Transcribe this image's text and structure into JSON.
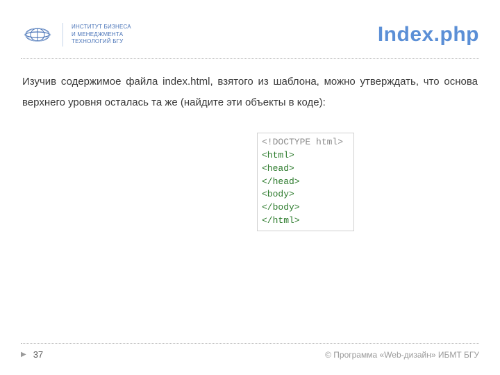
{
  "org": {
    "line1": "ИНСТИТУТ БИЗНЕСА",
    "line2": "И МЕНЕДЖМЕНТА",
    "line3": "ТЕХНОЛОГИЙ БГУ"
  },
  "title": "Index.php",
  "body_text": "Изучив содержимое файла index.html, взятого из шаблона, можно утверждать, что основа верхнего уровня осталась та же (найдите эти объекты в коде):",
  "code": {
    "line1": "<!DOCTYPE html>",
    "line2": "<html>",
    "line3": "<head>",
    "blank1": "",
    "line4": "</head>",
    "line5": "<body>",
    "blank2": "",
    "line6": "</body>",
    "line7": "</html>"
  },
  "footer": {
    "page": "37",
    "copyright": "© Программа «Web-дизайн» ИБМТ БГУ"
  }
}
